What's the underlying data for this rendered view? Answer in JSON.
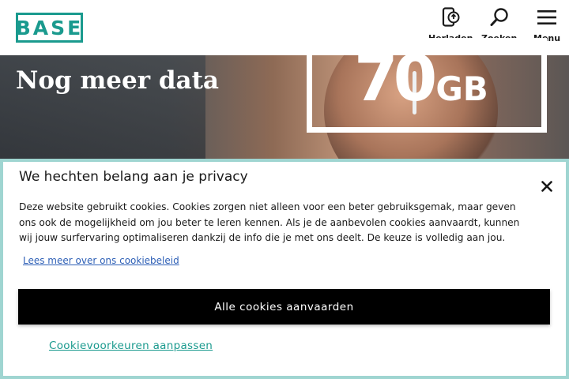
{
  "header": {
    "logo_text": "BASE",
    "nav": [
      {
        "label": "Herladen",
        "icon": "phone-recharge-icon"
      },
      {
        "label": "Zoeken",
        "icon": "search-icon"
      },
      {
        "label": "Menu",
        "icon": "hamburger-menu-icon"
      }
    ]
  },
  "hero": {
    "title": "Nog meer data",
    "promo_number": "70",
    "promo_unit": "GB"
  },
  "cookie_modal": {
    "title": "We hechten belang aan je privacy",
    "close_icon": "close-icon",
    "body": "Deze website gebruikt cookies. Cookies zorgen niet alleen voor een beter gebruiksgemak, maar geven ons ook de mogelijkheid om jou beter te leren kennen. Als je de aanbevolen cookies aanvaardt, kunnen wij jouw surfervaring optimaliseren dankzij de info die je met ons deelt. De keuze is volledig aan jou.",
    "policy_link": "Lees meer over ons cookiebeleid",
    "accept_button": "Alle cookies aanvaarden",
    "preferences_link": "Cookievoorkeuren aanpassen"
  },
  "colors": {
    "brand_teal": "#1a9a8e",
    "modal_border": "#9fd5d1",
    "link_blue": "#2d5fb6",
    "button_black": "#000000"
  }
}
